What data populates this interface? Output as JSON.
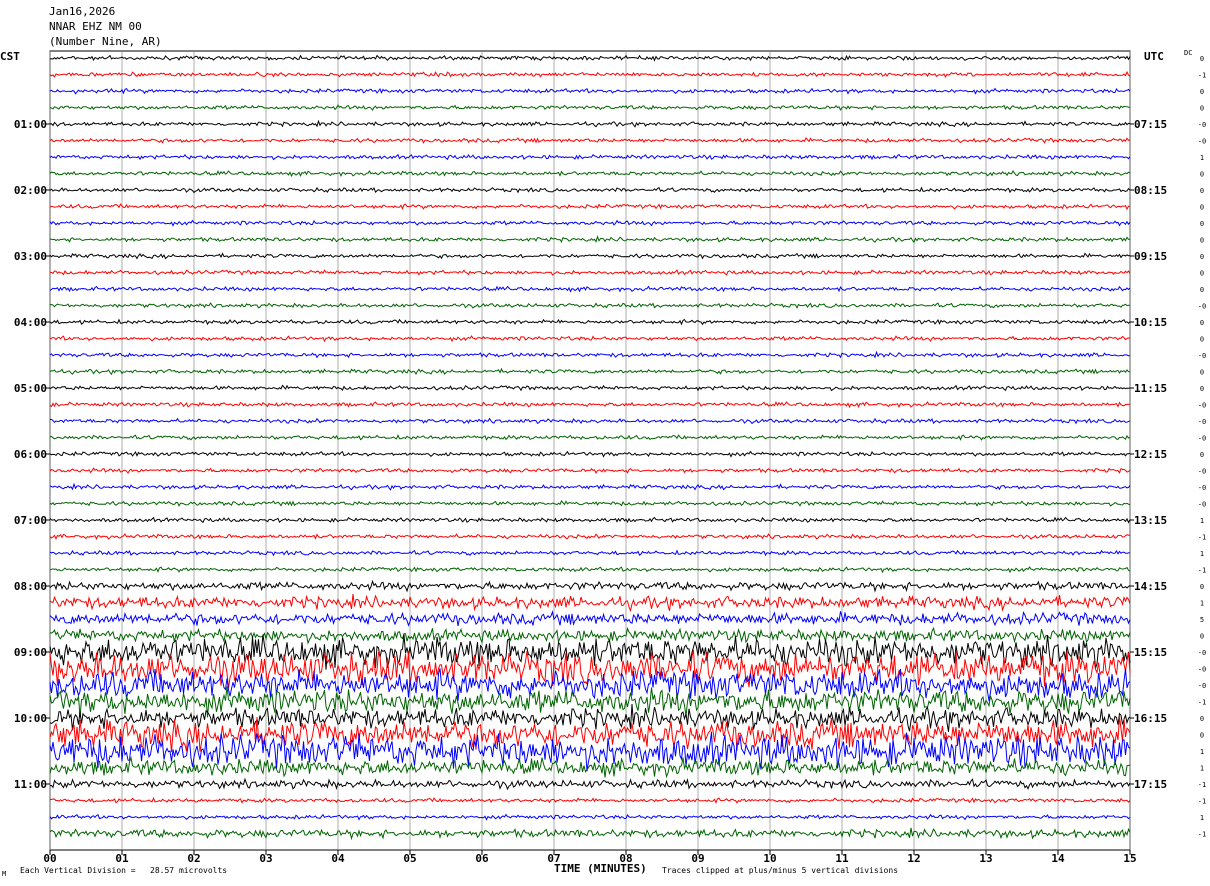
{
  "header": {
    "date": "Jan16,2026",
    "station": "NNAR EHZ NM 00",
    "location": "(Number Nine, AR)"
  },
  "left_timezone": "CST",
  "right_timezone": "UTC",
  "dc_label": "DC",
  "corner_mark": "M",
  "footer": {
    "vertical_division": "Each Vertical Division =   28.57 microvolts",
    "clip_note": "Traces clipped at plus/minus 5 vertical divisions"
  },
  "chart_data": {
    "type": "line",
    "title": "",
    "xlabel": "TIME (MINUTES)",
    "ylabel": "",
    "xlim": [
      0,
      15
    ],
    "x_ticks": [
      "00",
      "01",
      "02",
      "03",
      "04",
      "05",
      "06",
      "07",
      "08",
      "09",
      "10",
      "11",
      "12",
      "13",
      "14",
      "15"
    ],
    "trace_colors": [
      "#000000",
      "#ff0000",
      "#0000ff",
      "#006400"
    ],
    "trace_count": 48,
    "minutes_per_trace": 15,
    "left_hour_labels": [
      "01:00",
      "02:00",
      "03:00",
      "04:00",
      "05:00",
      "06:00",
      "07:00",
      "08:00",
      "09:00",
      "10:00",
      "11:00"
    ],
    "right_hour_labels": [
      "07:15",
      "08:15",
      "09:15",
      "10:15",
      "11:15",
      "12:15",
      "13:15",
      "14:15",
      "15:15",
      "16:15",
      "17:15"
    ],
    "dc_offsets": [
      "0",
      "-1",
      "0",
      "0",
      "-0",
      "-0",
      "1",
      "0",
      "0",
      "0",
      "0",
      "0",
      "0",
      "0",
      "0",
      "-0",
      "0",
      "0",
      "-0",
      "0",
      "0",
      "-0",
      "-0",
      "-0",
      "0",
      "-0",
      "-0",
      "-0",
      "1",
      "-1",
      "1",
      "-1",
      "0",
      "1",
      "5",
      "0",
      "-0",
      "-0",
      "-0",
      "-1",
      "0",
      "0",
      "1",
      "1",
      "-1",
      "-1",
      "1",
      "-1",
      "-1",
      "-1"
    ],
    "trace_noise_level": [
      1,
      1,
      1,
      1,
      1,
      1,
      1,
      1,
      1,
      1,
      1,
      1,
      1,
      1,
      1,
      1,
      1,
      1,
      1,
      1,
      1,
      1,
      1,
      1,
      1,
      1,
      1,
      1,
      1,
      1,
      1,
      1,
      2,
      3,
      3,
      3,
      7,
      8,
      7,
      6,
      5,
      7,
      8,
      4,
      2,
      1,
      1,
      2,
      1,
      2,
      1,
      1,
      1,
      1,
      1,
      1,
      1,
      1,
      1,
      3,
      6,
      7
    ]
  }
}
